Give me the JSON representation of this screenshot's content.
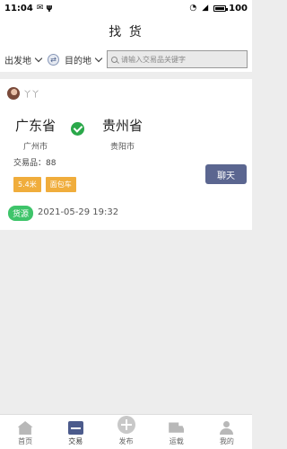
{
  "status_bar": {
    "time": "11:04",
    "battery": "100"
  },
  "header": {
    "title": "找 货"
  },
  "filters": {
    "origin_label": "出发地",
    "destination_label": "目的地",
    "search_placeholder": "请输入交易品关键字"
  },
  "listing": {
    "username": "丫丫",
    "from_province": "广东省",
    "from_city": "广州市",
    "to_province": "贵州省",
    "to_city": "贵阳市",
    "goods": "交易品：88",
    "tags": [
      "5.4米",
      "面包车"
    ],
    "chat_label": "聊天",
    "source_badge": "货源",
    "datetime": "2021-05-29 19:32"
  },
  "tab_bar": {
    "active": "交易",
    "tabs": [
      {
        "label": "首页",
        "icon": "home-icon"
      },
      {
        "label": "交易",
        "icon": "trade-icon"
      },
      {
        "label": "发布",
        "icon": "plus-icon"
      },
      {
        "label": "运载",
        "icon": "truck-icon"
      },
      {
        "label": "我的",
        "icon": "person-icon"
      }
    ]
  }
}
